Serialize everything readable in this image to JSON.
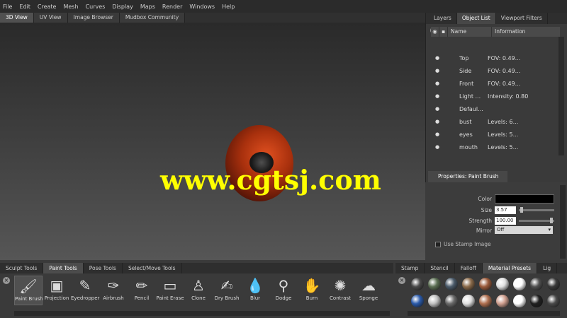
{
  "menu": [
    "File",
    "Edit",
    "Create",
    "Mesh",
    "Curves",
    "Display",
    "Maps",
    "Render",
    "Windows",
    "Help"
  ],
  "view_tabs": [
    {
      "label": "3D View",
      "active": true
    },
    {
      "label": "UV View",
      "active": false
    },
    {
      "label": "Image Browser",
      "active": false
    },
    {
      "label": "Mudbox Community",
      "active": false
    }
  ],
  "watermark": "www.cgtsj.com",
  "right_tabs": [
    {
      "label": "Layers",
      "active": false
    },
    {
      "label": "Object List",
      "active": true
    },
    {
      "label": "Viewport Filters",
      "active": false
    }
  ],
  "object_list": {
    "columns": {
      "name": "Name",
      "info": "Information"
    },
    "rows": [
      {
        "name": "Top",
        "info": "FOV: 0.49..."
      },
      {
        "name": "Side",
        "info": "FOV: 0.49..."
      },
      {
        "name": "Front",
        "info": "FOV: 0.49..."
      },
      {
        "name": "Light ...",
        "info": "Intensity: 0.80"
      },
      {
        "name": "Defaul...",
        "info": ""
      },
      {
        "name": "bust",
        "info": "Levels: 6..."
      },
      {
        "name": "eyes",
        "info": "Levels: 5..."
      },
      {
        "name": "mouth",
        "info": "Levels: 5..."
      }
    ]
  },
  "properties": {
    "tab": "Properties: Paint Brush",
    "color_label": "Color",
    "color_value": "#000000",
    "size_label": "Size",
    "size_value": "3.57",
    "strength_label": "Strength",
    "strength_value": "100.00",
    "mirror_label": "Mirror",
    "mirror_value": "Off",
    "stamp_label": "Use Stamp Image"
  },
  "tool_tabs": [
    {
      "label": "Sculpt Tools",
      "active": false
    },
    {
      "label": "Paint Tools",
      "active": true
    },
    {
      "label": "Pose Tools",
      "active": false
    },
    {
      "label": "Select/Move Tools",
      "active": false
    }
  ],
  "tools": [
    {
      "label": "Paint Brush",
      "icon": "paint-brush-icon",
      "glyph": "🖌",
      "active": true
    },
    {
      "label": "Projection",
      "icon": "projection-icon",
      "glyph": "▣",
      "active": false
    },
    {
      "label": "Eyedropper",
      "icon": "eyedropper-icon",
      "glyph": "✎",
      "active": false
    },
    {
      "label": "Airbrush",
      "icon": "airbrush-icon",
      "glyph": "✑",
      "active": false
    },
    {
      "label": "Pencil",
      "icon": "pencil-icon",
      "glyph": "✏",
      "active": false
    },
    {
      "label": "Paint Erase",
      "icon": "eraser-icon",
      "glyph": "▭",
      "active": false
    },
    {
      "label": "Clone",
      "icon": "clone-icon",
      "glyph": "♙",
      "active": false
    },
    {
      "label": "Dry Brush",
      "icon": "dry-brush-icon",
      "glyph": "✍",
      "active": false
    },
    {
      "label": "Blur",
      "icon": "blur-icon",
      "glyph": "💧",
      "active": false
    },
    {
      "label": "Dodge",
      "icon": "dodge-icon",
      "glyph": "⚲",
      "active": false
    },
    {
      "label": "Burn",
      "icon": "burn-icon",
      "glyph": "✋",
      "active": false
    },
    {
      "label": "Contrast",
      "icon": "contrast-icon",
      "glyph": "✺",
      "active": false
    },
    {
      "label": "Sponge",
      "icon": "sponge-icon",
      "glyph": "☁",
      "active": false
    }
  ],
  "mat_tabs": [
    {
      "label": "Stamp",
      "active": false
    },
    {
      "label": "Stencil",
      "active": false
    },
    {
      "label": "Falloff",
      "active": false
    },
    {
      "label": "Material Presets",
      "active": true
    },
    {
      "label": "Lig",
      "active": false
    }
  ],
  "material_colors": [
    "#4a4a4a",
    "#5a6e52",
    "#4a5a6a",
    "#8a6a4a",
    "#9a5a3a",
    "#e0e0e0",
    "#ffffff",
    "#505050",
    "#3a3a3a",
    "#2a5aaa",
    "#c0c0c0",
    "#6a6a6a",
    "#e0e0e0",
    "#b07050",
    "#d0a090",
    "#ffffff",
    "#202020",
    "#4a4a4a"
  ]
}
